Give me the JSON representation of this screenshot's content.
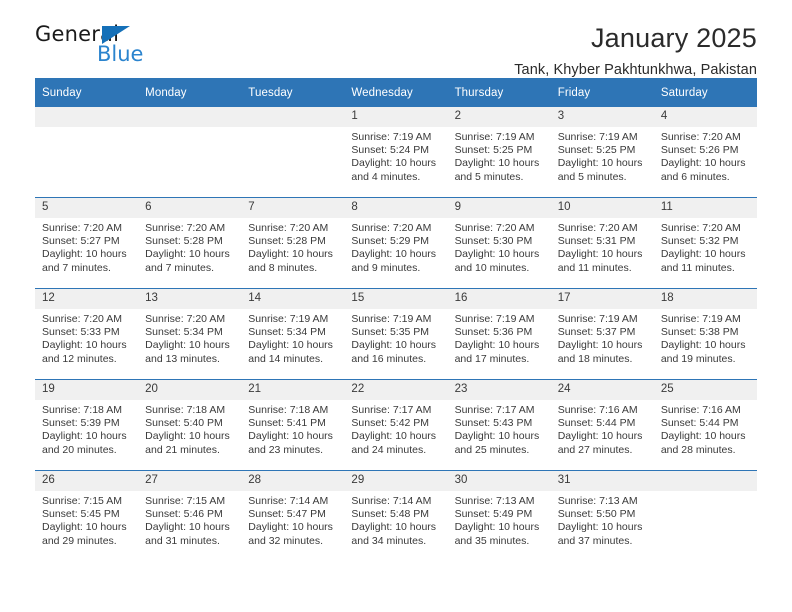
{
  "brand": {
    "name_top": "General",
    "name_bottom": "Blue",
    "flag_icon": "blue-triangle-flag-icon",
    "accent_color": "#2b84ce",
    "flag_color": "#1570b8"
  },
  "header": {
    "title": "January 2025",
    "subtitle": "Tank, Khyber Pakhtunkhwa, Pakistan"
  },
  "calendar": {
    "header_bg": "#2e75b6",
    "daynum_bg": "#f0f0f0",
    "weekday_headers": [
      "Sunday",
      "Monday",
      "Tuesday",
      "Wednesday",
      "Thursday",
      "Friday",
      "Saturday"
    ],
    "weeks": [
      [
        {
          "day": "",
          "sunrise": "",
          "sunset": "",
          "daylight": "",
          "blank": true
        },
        {
          "day": "",
          "sunrise": "",
          "sunset": "",
          "daylight": "",
          "blank": true
        },
        {
          "day": "",
          "sunrise": "",
          "sunset": "",
          "daylight": "",
          "blank": true
        },
        {
          "day": "1",
          "sunrise": "Sunrise: 7:19 AM",
          "sunset": "Sunset: 5:24 PM",
          "daylight": "Daylight: 10 hours and 4 minutes."
        },
        {
          "day": "2",
          "sunrise": "Sunrise: 7:19 AM",
          "sunset": "Sunset: 5:25 PM",
          "daylight": "Daylight: 10 hours and 5 minutes."
        },
        {
          "day": "3",
          "sunrise": "Sunrise: 7:19 AM",
          "sunset": "Sunset: 5:25 PM",
          "daylight": "Daylight: 10 hours and 5 minutes."
        },
        {
          "day": "4",
          "sunrise": "Sunrise: 7:20 AM",
          "sunset": "Sunset: 5:26 PM",
          "daylight": "Daylight: 10 hours and 6 minutes."
        }
      ],
      [
        {
          "day": "5",
          "sunrise": "Sunrise: 7:20 AM",
          "sunset": "Sunset: 5:27 PM",
          "daylight": "Daylight: 10 hours and 7 minutes."
        },
        {
          "day": "6",
          "sunrise": "Sunrise: 7:20 AM",
          "sunset": "Sunset: 5:28 PM",
          "daylight": "Daylight: 10 hours and 7 minutes."
        },
        {
          "day": "7",
          "sunrise": "Sunrise: 7:20 AM",
          "sunset": "Sunset: 5:28 PM",
          "daylight": "Daylight: 10 hours and 8 minutes."
        },
        {
          "day": "8",
          "sunrise": "Sunrise: 7:20 AM",
          "sunset": "Sunset: 5:29 PM",
          "daylight": "Daylight: 10 hours and 9 minutes."
        },
        {
          "day": "9",
          "sunrise": "Sunrise: 7:20 AM",
          "sunset": "Sunset: 5:30 PM",
          "daylight": "Daylight: 10 hours and 10 minutes."
        },
        {
          "day": "10",
          "sunrise": "Sunrise: 7:20 AM",
          "sunset": "Sunset: 5:31 PM",
          "daylight": "Daylight: 10 hours and 11 minutes."
        },
        {
          "day": "11",
          "sunrise": "Sunrise: 7:20 AM",
          "sunset": "Sunset: 5:32 PM",
          "daylight": "Daylight: 10 hours and 11 minutes."
        }
      ],
      [
        {
          "day": "12",
          "sunrise": "Sunrise: 7:20 AM",
          "sunset": "Sunset: 5:33 PM",
          "daylight": "Daylight: 10 hours and 12 minutes."
        },
        {
          "day": "13",
          "sunrise": "Sunrise: 7:20 AM",
          "sunset": "Sunset: 5:34 PM",
          "daylight": "Daylight: 10 hours and 13 minutes."
        },
        {
          "day": "14",
          "sunrise": "Sunrise: 7:19 AM",
          "sunset": "Sunset: 5:34 PM",
          "daylight": "Daylight: 10 hours and 14 minutes."
        },
        {
          "day": "15",
          "sunrise": "Sunrise: 7:19 AM",
          "sunset": "Sunset: 5:35 PM",
          "daylight": "Daylight: 10 hours and 16 minutes."
        },
        {
          "day": "16",
          "sunrise": "Sunrise: 7:19 AM",
          "sunset": "Sunset: 5:36 PM",
          "daylight": "Daylight: 10 hours and 17 minutes."
        },
        {
          "day": "17",
          "sunrise": "Sunrise: 7:19 AM",
          "sunset": "Sunset: 5:37 PM",
          "daylight": "Daylight: 10 hours and 18 minutes."
        },
        {
          "day": "18",
          "sunrise": "Sunrise: 7:19 AM",
          "sunset": "Sunset: 5:38 PM",
          "daylight": "Daylight: 10 hours and 19 minutes."
        }
      ],
      [
        {
          "day": "19",
          "sunrise": "Sunrise: 7:18 AM",
          "sunset": "Sunset: 5:39 PM",
          "daylight": "Daylight: 10 hours and 20 minutes."
        },
        {
          "day": "20",
          "sunrise": "Sunrise: 7:18 AM",
          "sunset": "Sunset: 5:40 PM",
          "daylight": "Daylight: 10 hours and 21 minutes."
        },
        {
          "day": "21",
          "sunrise": "Sunrise: 7:18 AM",
          "sunset": "Sunset: 5:41 PM",
          "daylight": "Daylight: 10 hours and 23 minutes."
        },
        {
          "day": "22",
          "sunrise": "Sunrise: 7:17 AM",
          "sunset": "Sunset: 5:42 PM",
          "daylight": "Daylight: 10 hours and 24 minutes."
        },
        {
          "day": "23",
          "sunrise": "Sunrise: 7:17 AM",
          "sunset": "Sunset: 5:43 PM",
          "daylight": "Daylight: 10 hours and 25 minutes."
        },
        {
          "day": "24",
          "sunrise": "Sunrise: 7:16 AM",
          "sunset": "Sunset: 5:44 PM",
          "daylight": "Daylight: 10 hours and 27 minutes."
        },
        {
          "day": "25",
          "sunrise": "Sunrise: 7:16 AM",
          "sunset": "Sunset: 5:44 PM",
          "daylight": "Daylight: 10 hours and 28 minutes."
        }
      ],
      [
        {
          "day": "26",
          "sunrise": "Sunrise: 7:15 AM",
          "sunset": "Sunset: 5:45 PM",
          "daylight": "Daylight: 10 hours and 29 minutes."
        },
        {
          "day": "27",
          "sunrise": "Sunrise: 7:15 AM",
          "sunset": "Sunset: 5:46 PM",
          "daylight": "Daylight: 10 hours and 31 minutes."
        },
        {
          "day": "28",
          "sunrise": "Sunrise: 7:14 AM",
          "sunset": "Sunset: 5:47 PM",
          "daylight": "Daylight: 10 hours and 32 minutes."
        },
        {
          "day": "29",
          "sunrise": "Sunrise: 7:14 AM",
          "sunset": "Sunset: 5:48 PM",
          "daylight": "Daylight: 10 hours and 34 minutes."
        },
        {
          "day": "30",
          "sunrise": "Sunrise: 7:13 AM",
          "sunset": "Sunset: 5:49 PM",
          "daylight": "Daylight: 10 hours and 35 minutes."
        },
        {
          "day": "31",
          "sunrise": "Sunrise: 7:13 AM",
          "sunset": "Sunset: 5:50 PM",
          "daylight": "Daylight: 10 hours and 37 minutes."
        },
        {
          "day": "",
          "sunrise": "",
          "sunset": "",
          "daylight": "",
          "blank": true
        }
      ]
    ]
  }
}
